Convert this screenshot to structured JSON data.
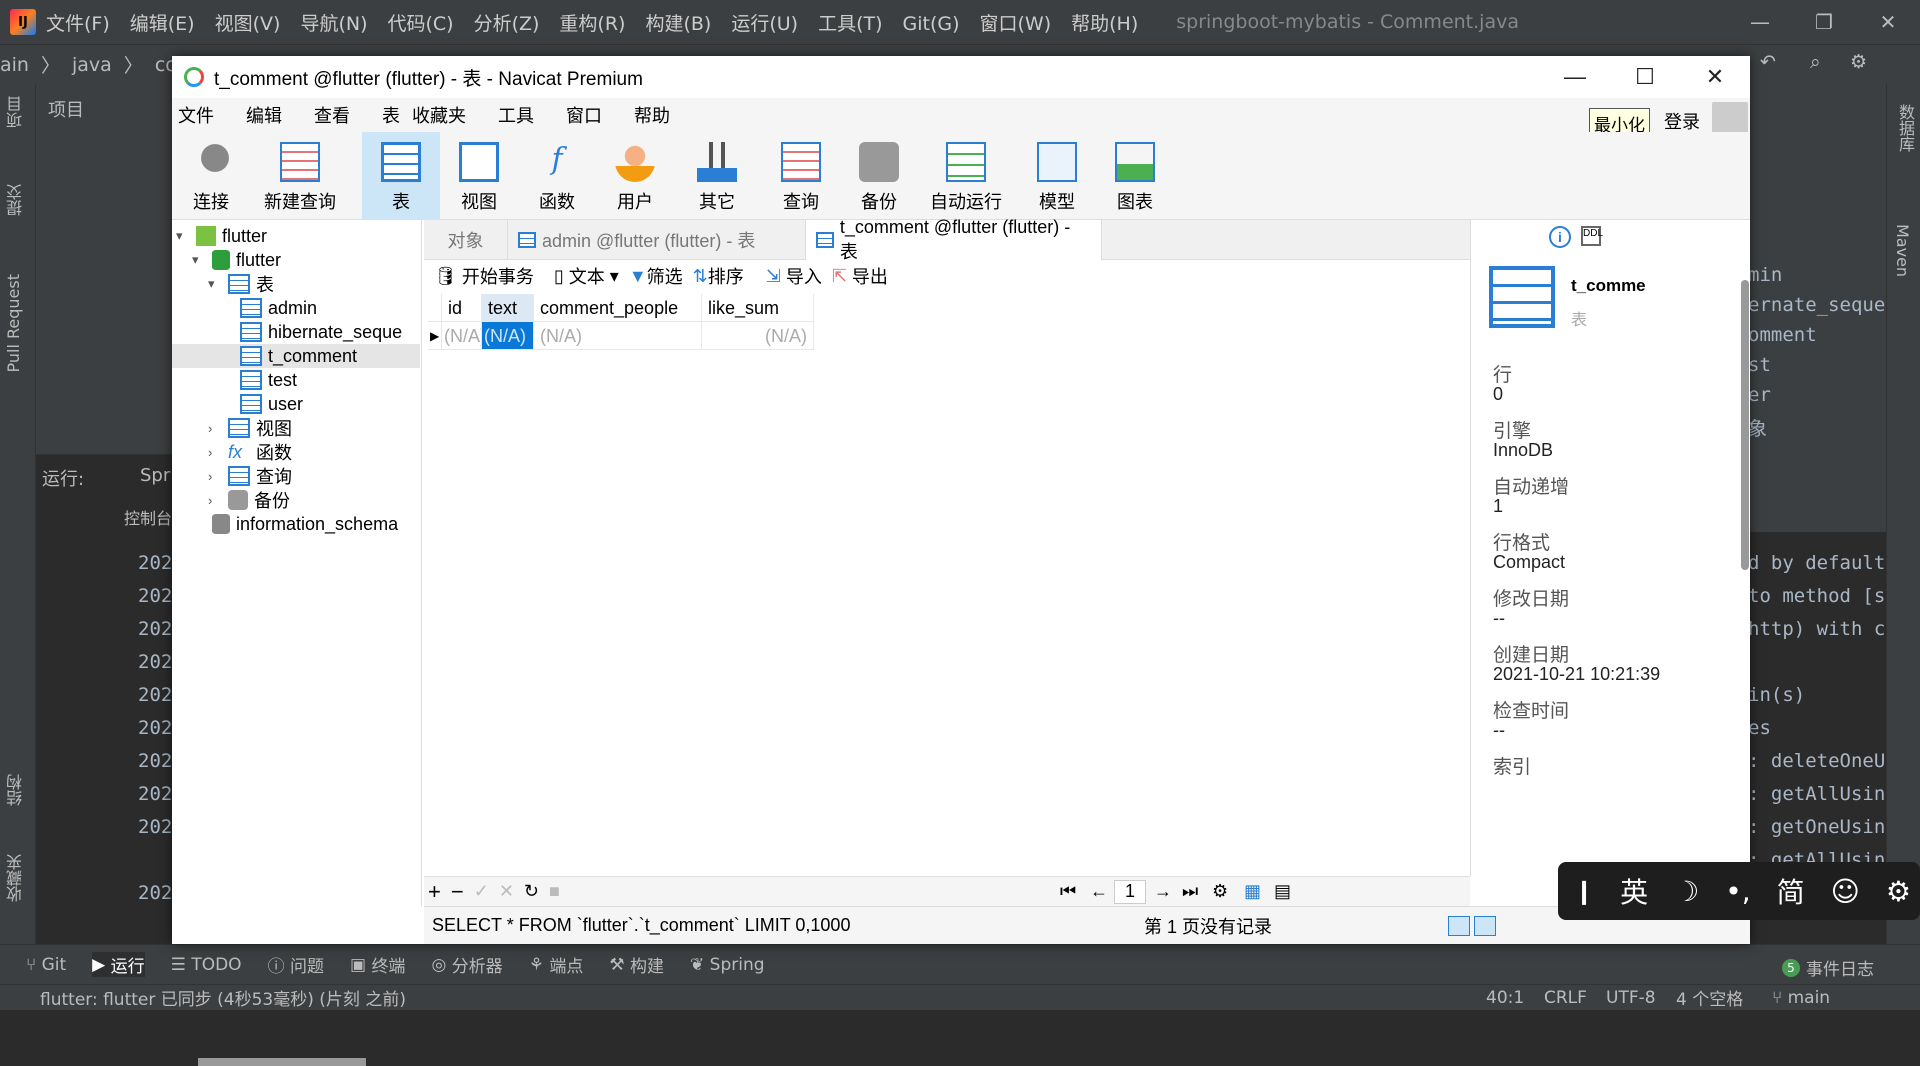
{
  "ide": {
    "menu": [
      "文件(F)",
      "编辑(E)",
      "视图(V)",
      "导航(N)",
      "代码(C)",
      "分析(Z)",
      "重构(R)",
      "构建(B)",
      "运行(U)",
      "工具(T)",
      "Git(G)",
      "窗口(W)",
      "帮助(H)"
    ],
    "project_title": "springboot-mybatis - Comment.java",
    "breadcrumb": [
      "ain",
      "java",
      "com"
    ],
    "project_label": "项目",
    "run_label": "运行:",
    "run_config": "Spr",
    "console_tab": "控制台",
    "log_prefix": "202",
    "left_tabs": [
      "项目",
      "提交",
      "Pull Request",
      "结构",
      "收藏夹"
    ],
    "right_tabs": [
      "数据库",
      "Maven"
    ],
    "right_code": [
      "min",
      "ernate_sequenc",
      "omment",
      "st",
      "er",
      "象"
    ],
    "console_code": [
      "d by default",
      "to method [s",
      "http) with c",
      "",
      "in(s)",
      "es",
      ": deleteOneU",
      ": getAllUsin",
      ": getOneUsin",
      ": getAllUsin"
    ],
    "bottom_tabs": [
      "Git",
      "运行",
      "TODO",
      "问题",
      "终端",
      "分析器",
      "端点",
      "构建",
      "Spring"
    ],
    "event_log": "事件日志",
    "event_count": "5",
    "status_left": "flutter: flutter 已同步 (4秒53毫秒) (片刻 之前)",
    "status_right": [
      "40:1",
      "CRLF",
      "UTF-8",
      "4 个空格",
      "main"
    ]
  },
  "navicat": {
    "title": "t_comment @flutter (flutter) - 表 - Navicat Premium",
    "menu": [
      "文件",
      "编辑",
      "查看",
      "表",
      "收藏夹",
      "工具",
      "窗口",
      "帮助"
    ],
    "toolbar": [
      "连接",
      "新建查询",
      "表",
      "视图",
      "函数",
      "用户",
      "其它",
      "查询",
      "备份",
      "自动运行",
      "模型",
      "图表"
    ],
    "tooltip": "最小化",
    "login": "登录",
    "tree": {
      "conn": "flutter",
      "db": "flutter",
      "tables_label": "表",
      "tables": [
        "admin",
        "hibernate_seque",
        "t_comment",
        "test",
        "user"
      ],
      "groups": [
        "视图",
        "函数",
        "查询",
        "备份"
      ],
      "other_db": "information_schema"
    },
    "tabs": [
      "对象",
      "admin @flutter (flutter) - 表",
      "t_comment @flutter (flutter) - 表"
    ],
    "grid_toolbar": [
      "开始事务",
      "文本",
      "筛选",
      "排序",
      "导入",
      "导出"
    ],
    "columns": [
      "id",
      "text",
      "comment_people",
      "like_sum"
    ],
    "row": [
      "(N/A)",
      "(N/A)",
      "(N/A)",
      "(N/A)"
    ],
    "page": "1",
    "sql": "SELECT * FROM `flutter`.`t_comment` LIMIT 0,1000",
    "page_status": "第 1 页没有记录",
    "info": {
      "name": "t_comme",
      "type": "表",
      "fields": [
        {
          "label": "行",
          "value": "0"
        },
        {
          "label": "引擎",
          "value": "InnoDB"
        },
        {
          "label": "自动递增",
          "value": "1"
        },
        {
          "label": "行格式",
          "value": "Compact"
        },
        {
          "label": "修改日期",
          "value": "--"
        },
        {
          "label": "创建日期",
          "value": "2021-10-21 10:21:39"
        },
        {
          "label": "检查时间",
          "value": "--"
        },
        {
          "label": "索引",
          "value": ""
        }
      ]
    }
  },
  "ime": [
    "英",
    "简"
  ]
}
